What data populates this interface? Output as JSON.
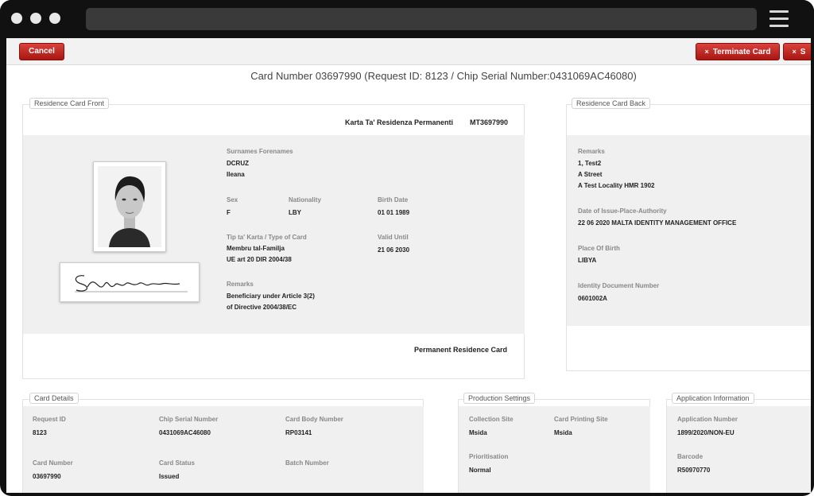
{
  "toolbar": {
    "cancel_label": "Cancel",
    "terminate_label": "Terminate Card",
    "second_label": "S",
    "close_glyph": "×"
  },
  "title": "Card Number 03697990 (Request ID: 8123 / Chip Serial Number:0431069AC46080)",
  "front": {
    "legend": "Residence Card Front",
    "header_name": "Karta Ta' Residenza Permanenti",
    "header_code": "MT3697990",
    "surnames_label": "Surnames Forenames",
    "surname": "DCRUZ",
    "forename": "Ileana",
    "sex_label": "Sex",
    "sex": "F",
    "nationality_label": "Nationality",
    "nationality": "LBY",
    "birth_label": "Birth Date",
    "birth": "01 01 1989",
    "type_label": "Tip ta' Karta / Type of Card",
    "type_line1": "Membru tal-Familja",
    "type_line2": "UE art 20 DIR 2004/38",
    "valid_label": "Valid Until",
    "valid": "21 06 2030",
    "remarks_label": "Remarks",
    "remarks_line1": "Beneficiary under Article 3(2)",
    "remarks_line2": "of Directive 2004/38/EC",
    "footer": "Permanent Residence Card"
  },
  "back": {
    "legend": "Residence Card Back",
    "remarks_label": "Remarks",
    "remarks_line1": "1, Test2",
    "remarks_line2": "A Street",
    "remarks_line3": "A Test Locality HMR 1902",
    "issue_label": "Date of Issue-Place-Authority",
    "issue": "22 06 2020 MALTA IDENTITY MANAGEMENT OFFICE",
    "pob_label": "Place Of Birth",
    "pob": "LIBYA",
    "iddoc_label": "Identity Document Number",
    "iddoc": "0601002A"
  },
  "card_details": {
    "legend": "Card Details",
    "request_label": "Request ID",
    "request": "8123",
    "chip_label": "Chip Serial Number",
    "chip": "0431069AC46080",
    "body_label": "Card Body Number",
    "body": "RP03141",
    "cardno_label": "Card Number",
    "cardno": "03697990",
    "status_label": "Card Status",
    "status": "Issued",
    "batch_label": "Batch Number"
  },
  "production": {
    "legend": "Production Settings",
    "site_label": "Collection Site",
    "site": "Msida",
    "printing_label": "Card Printing Site",
    "printing": "Msida",
    "prio_label": "Prioritisation",
    "prio": "Normal"
  },
  "application": {
    "legend": "Application Information",
    "number_label": "Application Number",
    "number": "1899/2020/NON-EU",
    "barcode_label": "Barcode",
    "barcode": "R50970770"
  },
  "colors": {
    "accent_red": "#c0201b",
    "panel_grey": "#f0f0f0"
  }
}
